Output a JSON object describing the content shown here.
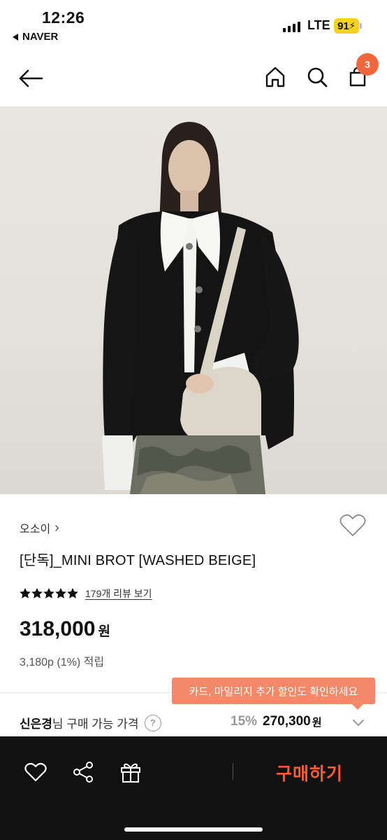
{
  "status_bar": {
    "time": "12:26",
    "back_app": "NAVER",
    "network": "LTE",
    "battery": "91"
  },
  "header": {
    "icons": [
      "back-arrow-icon",
      "home-icon",
      "search-icon",
      "cart-icon"
    ],
    "cart_count": "3",
    "accent_color": "#f0663f"
  },
  "product": {
    "brand": "오소이",
    "brand_chevron": "›",
    "title": "[단독]_MINI BROT [WASHED BEIGE]",
    "rating_stars": 5,
    "review_link": "179개 리뷰 보기",
    "price_number": "318,000",
    "price_unit": "원",
    "points": "3,180p (1%) 적립"
  },
  "promo": {
    "tooltip": "카드, 마일리지 추가 할인도 확인하세요",
    "member_name": "신은경",
    "member_label": "님 구매 가능 가격",
    "help": "?",
    "discount_pct": "15%",
    "member_price": "270,300",
    "member_price_unit": "원"
  },
  "bottom_bar": {
    "icons": [
      "heart-icon",
      "share-icon",
      "gift-icon"
    ],
    "buy_label": "구매하기",
    "buy_color": "#ff5a35"
  }
}
